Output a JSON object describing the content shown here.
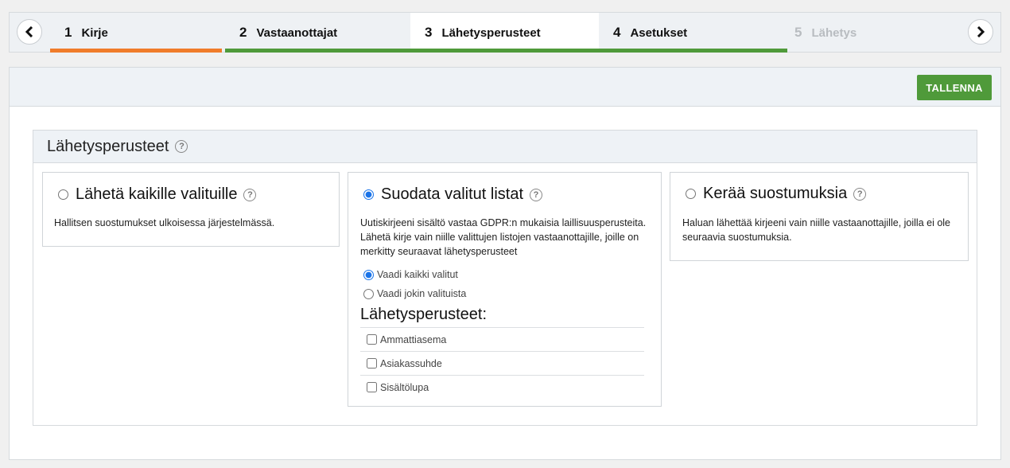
{
  "wizard": {
    "steps": [
      {
        "num": "1",
        "label": "Kirje"
      },
      {
        "num": "2",
        "label": "Vastaanottajat"
      },
      {
        "num": "3",
        "label": "Lähetysperusteet"
      },
      {
        "num": "4",
        "label": "Asetukset"
      },
      {
        "num": "5",
        "label": "Lähetys"
      }
    ],
    "colors": {
      "step1_bar": "#f07c2a",
      "completed_bar": "#4f9a3a"
    }
  },
  "toolbar": {
    "save_label": "TALLENNA"
  },
  "section": {
    "title": "Lähetysperusteet",
    "help": "?",
    "cards": [
      {
        "title": "Lähetä kaikille valituille",
        "description": "Hallitsen suostumukset ulkoisessa järjestelmässä.",
        "selected": false
      },
      {
        "title": "Suodata valitut listat",
        "description": "Uutiskirjeeni sisältö vastaa GDPR:n mukaisia laillisuusperusteita. Lähetä kirje vain niille valittujen listojen vastaanottajille, joille on merkitty seuraavat lähetysperusteet",
        "selected": true,
        "match_options": [
          "Vaadi kaikki valitut",
          "Vaadi jokin valituista"
        ],
        "criteria_title": "Lähetysperusteet:",
        "criteria": [
          "Ammattiasema",
          "Asiakassuhde",
          "Sisältölupa"
        ]
      },
      {
        "title": "Kerää suostumuksia",
        "description": "Haluan lähettää kirjeeni vain niille vastaanottajille, joilla ei ole seuraavia suostumuksia.",
        "selected": false
      }
    ]
  }
}
